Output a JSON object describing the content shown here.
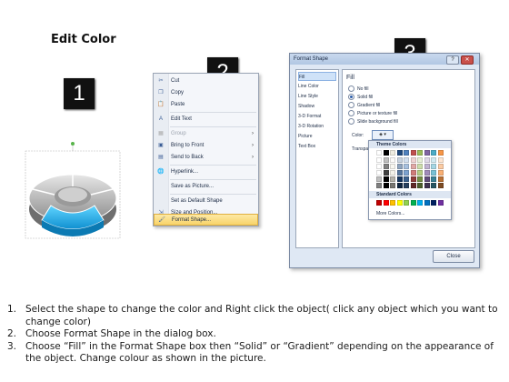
{
  "page": {
    "title": "Edit Color"
  },
  "badges": [
    "1",
    "2",
    "3"
  ],
  "context_menu": {
    "items": [
      {
        "label": "Cut",
        "icon": "scissors-icon",
        "glyph": "✂"
      },
      {
        "label": "Copy",
        "icon": "copy-icon",
        "glyph": "❐"
      },
      {
        "label": "Paste",
        "icon": "paste-icon",
        "glyph": "📋"
      },
      {
        "label": "Edit Text",
        "icon": "edit-text-icon",
        "glyph": "A"
      },
      {
        "label": "Group",
        "icon": "group-icon",
        "glyph": "▦"
      },
      {
        "label": "Bring to Front",
        "icon": "bring-front-icon",
        "glyph": "▣"
      },
      {
        "label": "Send to Back",
        "icon": "send-back-icon",
        "glyph": "▤"
      },
      {
        "label": "Hyperlink...",
        "icon": "hyperlink-icon",
        "glyph": "🌐"
      },
      {
        "label": "Save as Picture...",
        "icon": "",
        "glyph": ""
      },
      {
        "label": "Set as Default Shape",
        "icon": "",
        "glyph": ""
      },
      {
        "label": "Size and Position...",
        "icon": "size-position-icon",
        "glyph": "⇲"
      },
      {
        "label": "Format Shape...",
        "icon": "format-shape-icon",
        "glyph": "🖌"
      }
    ]
  },
  "dialog": {
    "title": "Format Shape",
    "help": "?",
    "close_glyph": "✕",
    "nav": [
      "Fill",
      "Line Color",
      "Line Style",
      "Shadow",
      "3-D Format",
      "3-D Rotation",
      "Picture",
      "Text Box"
    ],
    "section_title": "Fill",
    "options": [
      "No fill",
      "Solid fill",
      "Gradient fill",
      "Picture or texture fill",
      "Slide background fill"
    ],
    "selected_option": "Solid fill",
    "color_label": "Color:",
    "transparency_label": "Transpa",
    "close_button": "Close"
  },
  "palette": {
    "theme_label": "Theme Colors",
    "standard_label": "Standard Colors",
    "more_label": "More Colors...",
    "theme_top": [
      "#ffffff",
      "#000000",
      "#eeece1",
      "#1f497d",
      "#4f81bd",
      "#c0504d",
      "#9bbb59",
      "#8064a2",
      "#4bacc6",
      "#f79646"
    ],
    "standard": [
      "#c00000",
      "#ff0000",
      "#ffc000",
      "#ffff00",
      "#92d050",
      "#00b050",
      "#00b0f0",
      "#0070c0",
      "#002060",
      "#7030a0"
    ]
  },
  "instructions": [
    {
      "num": "1.",
      "text": "Select the shape to change the color and Right click the object( click any object which you want to change color)"
    },
    {
      "num": "2.",
      "text": "Choose Format Shape in the dialog box."
    },
    {
      "num": "3.",
      "text": "Choose “Fill” in the Format Shape box then “Solid” or “Gradient” depending on the appearance of the object. Change colour as shown in the picture."
    }
  ]
}
